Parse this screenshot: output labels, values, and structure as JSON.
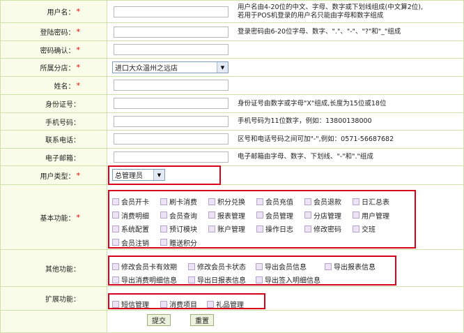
{
  "form": {
    "username": {
      "label": "用户名：",
      "value": "",
      "hint_line1": "用户名由4-20位的中文、字母、数字或下划线组成(中文算2位),",
      "hint_line2": "若用于POS机登录的用户名只能由字母和数字组成"
    },
    "password": {
      "label": "登陆密码：",
      "value": "",
      "hint": "登录密码由6-20位字母、数字、\".\"、\"-\"、\"?\"和\"_\"组成"
    },
    "confirm": {
      "label": "密码确认：",
      "value": ""
    },
    "branch": {
      "label": "所属分店：",
      "selected": "进口大众温州之远店"
    },
    "name": {
      "label": "姓名：",
      "value": ""
    },
    "idcard": {
      "label": "身份证号：",
      "value": "",
      "hint": "身份证号由数字或字母\"X\"组成,长度为15位或18位"
    },
    "mobile": {
      "label": "手机号码：",
      "value": "",
      "hint": "手机号码为11位数字，例如：13800138000"
    },
    "phone": {
      "label": "联系电话：",
      "value": "",
      "hint": "区号和电话号码之间可加\"-\",例如：0571-56687682"
    },
    "email": {
      "label": "电子邮箱：",
      "value": "",
      "hint": "电子邮箱由字母、数字、下划线、\"-\"和\".\"组成"
    },
    "usertype": {
      "label": "用户类型：",
      "selected": "总管理员"
    },
    "basic": {
      "label": "基本功能：",
      "items": [
        "会员开卡",
        "刷卡消费",
        "积分兑换",
        "会员充值",
        "会员退款",
        "日汇总表",
        "消费明细",
        "会员查询",
        "报表管理",
        "会员管理",
        "分店管理",
        "用户管理",
        "系统配置",
        "预订模块",
        "账户管理",
        "操作日志",
        "修改密码",
        "交班",
        "会员注销",
        "赠送积分"
      ]
    },
    "other": {
      "label": "其他功能：",
      "items": [
        "修改会员卡有效期",
        "修改会员卡状态",
        "导出会员信息",
        "导出报表信息",
        "导出消费明细信息",
        "导出日报表信息",
        "导出签入明细信息"
      ]
    },
    "ext": {
      "label": "扩展功能：",
      "items": [
        "短信管理",
        "消费项目",
        "礼品管理"
      ]
    },
    "required_mark": "*",
    "submit_label": "提交",
    "reset_label": "重置"
  },
  "colors": {
    "label_bg": "#f9fce8",
    "border": "#cfe0a8",
    "highlight": "#d9001b",
    "required": "#ee0000"
  },
  "icons": {
    "dropdown": "chevron-down-icon",
    "checkbox": "checkbox-icon"
  }
}
